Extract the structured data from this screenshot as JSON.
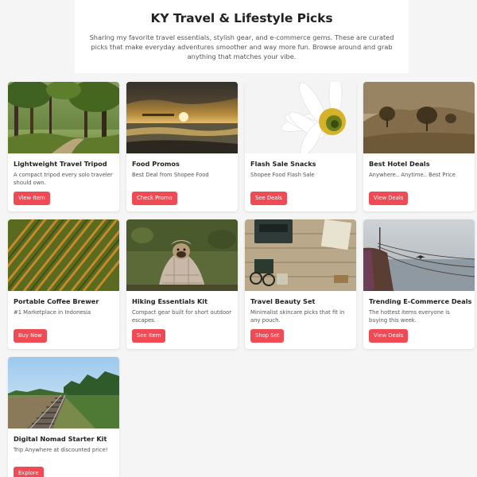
{
  "header": {
    "title": "KY Travel & Lifestyle Picks",
    "intro": "Sharing my favorite travel essentials, stylish gear, and e-commerce gems. These are curated picks that make everyday adventures smoother and way more fun. Browse around and grab anything that matches your vibe."
  },
  "cards": [
    {
      "title": "Lightweight Travel Tripod",
      "desc": "A compact tripod every solo traveler should own.",
      "button": "View Item",
      "image": "forest-path-photo"
    },
    {
      "title": "Food Promos",
      "desc": "Best Deal from Shopee Food",
      "button": "Check Promo",
      "image": "sunset-shore-photo"
    },
    {
      "title": "Flash Sale Snacks",
      "desc": "Shopee Food Flash Sale",
      "button": "See Deals",
      "image": "daisy-closeup-photo"
    },
    {
      "title": "Best Hotel Deals",
      "desc": "Anywhere.. Anytime.. Best Price",
      "button": "View Deals",
      "image": "sepia-hill-trees-photo"
    },
    {
      "title": "Portable Coffee Brewer",
      "desc": "#1 Marketplace in Indonesia",
      "button": "Buy Now",
      "image": "crop-field-rows-photo"
    },
    {
      "title": "Hiking Essentials Kit",
      "desc": "Compact gear built for short outdoor escapes.",
      "button": "See Item",
      "image": "pug-in-blanket-photo"
    },
    {
      "title": "Travel Beauty Set",
      "desc": "Minimalist skincare picks that fit in any pouch.",
      "button": "Shop Set",
      "image": "desk-typewriter-photo"
    },
    {
      "title": "Trending E-Commerce Deals",
      "desc": "The hottest items everyone is buying this week.",
      "button": "View Deals",
      "image": "boat-ropes-bird-photo"
    },
    {
      "title": "Digital Nomad Starter Kit",
      "desc": "Trip Anywhere at discounted price!",
      "button": "Explore",
      "image": "railway-tracks-photo"
    }
  ],
  "colors": {
    "accent": "#f04a54",
    "page_background": "#f5f5f5",
    "card_background": "#ffffff"
  }
}
